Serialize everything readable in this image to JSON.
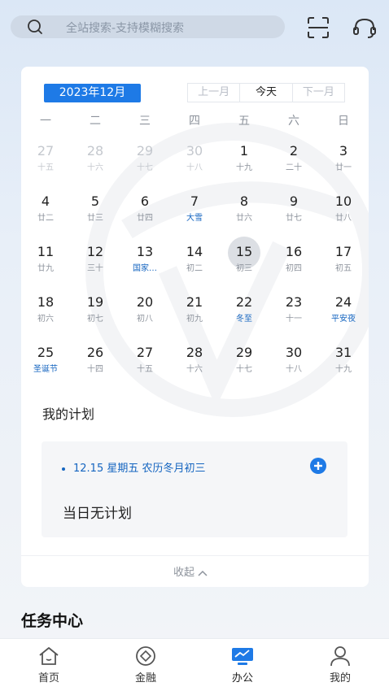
{
  "search": {
    "placeholder": "全站搜索-支持模糊搜索",
    "icon": "search-icon"
  },
  "header_icons": [
    "scan-icon",
    "headset-icon"
  ],
  "calendar": {
    "month_label": "2023年12月",
    "nav": {
      "prev": "上一月",
      "today": "今天",
      "next": "下一月"
    },
    "weekdays": [
      "一",
      "二",
      "三",
      "四",
      "五",
      "六",
      "日"
    ],
    "selected_day": "15",
    "rows": [
      [
        {
          "d": "27",
          "l": "十五",
          "prev": true
        },
        {
          "d": "28",
          "l": "十六",
          "prev": true
        },
        {
          "d": "29",
          "l": "十七",
          "prev": true
        },
        {
          "d": "30",
          "l": "十八",
          "prev": true
        },
        {
          "d": "1",
          "l": "十九"
        },
        {
          "d": "2",
          "l": "二十"
        },
        {
          "d": "3",
          "l": "廿一"
        }
      ],
      [
        {
          "d": "4",
          "l": "廿二"
        },
        {
          "d": "5",
          "l": "廿三"
        },
        {
          "d": "6",
          "l": "廿四"
        },
        {
          "d": "7",
          "l": "大雪",
          "hl": true
        },
        {
          "d": "8",
          "l": "廿六"
        },
        {
          "d": "9",
          "l": "廿七"
        },
        {
          "d": "10",
          "l": "廿八"
        }
      ],
      [
        {
          "d": "11",
          "l": "廿九"
        },
        {
          "d": "12",
          "l": "三十"
        },
        {
          "d": "13",
          "l": "国家…",
          "hl": true
        },
        {
          "d": "14",
          "l": "初二"
        },
        {
          "d": "15",
          "l": "初三",
          "sel": true
        },
        {
          "d": "16",
          "l": "初四"
        },
        {
          "d": "17",
          "l": "初五"
        }
      ],
      [
        {
          "d": "18",
          "l": "初六"
        },
        {
          "d": "19",
          "l": "初七"
        },
        {
          "d": "20",
          "l": "初八"
        },
        {
          "d": "21",
          "l": "初九"
        },
        {
          "d": "22",
          "l": "冬至",
          "hl": true
        },
        {
          "d": "23",
          "l": "十一"
        },
        {
          "d": "24",
          "l": "平安夜",
          "hl": true
        }
      ],
      [
        {
          "d": "25",
          "l": "圣诞节",
          "hl": true
        },
        {
          "d": "26",
          "l": "十四"
        },
        {
          "d": "27",
          "l": "十五"
        },
        {
          "d": "28",
          "l": "十六"
        },
        {
          "d": "29",
          "l": "十七"
        },
        {
          "d": "30",
          "l": "十八"
        },
        {
          "d": "31",
          "l": "十九"
        }
      ]
    ]
  },
  "plan": {
    "title": "我的计划",
    "date_line": "12.15 星期五 农历冬月初三",
    "empty": "当日无计划",
    "collapse": "收起"
  },
  "task_center": {
    "title": "任务中心"
  },
  "tabbar": {
    "items": [
      {
        "label": "首页",
        "icon": "home-icon"
      },
      {
        "label": "金融",
        "icon": "finance-icon"
      },
      {
        "label": "办公",
        "icon": "office-icon",
        "active": true
      },
      {
        "label": "我的",
        "icon": "profile-icon"
      }
    ]
  },
  "colors": {
    "accent": "#1e7ae6",
    "highlight_text": "#1565c0",
    "muted": "#8d939c"
  }
}
